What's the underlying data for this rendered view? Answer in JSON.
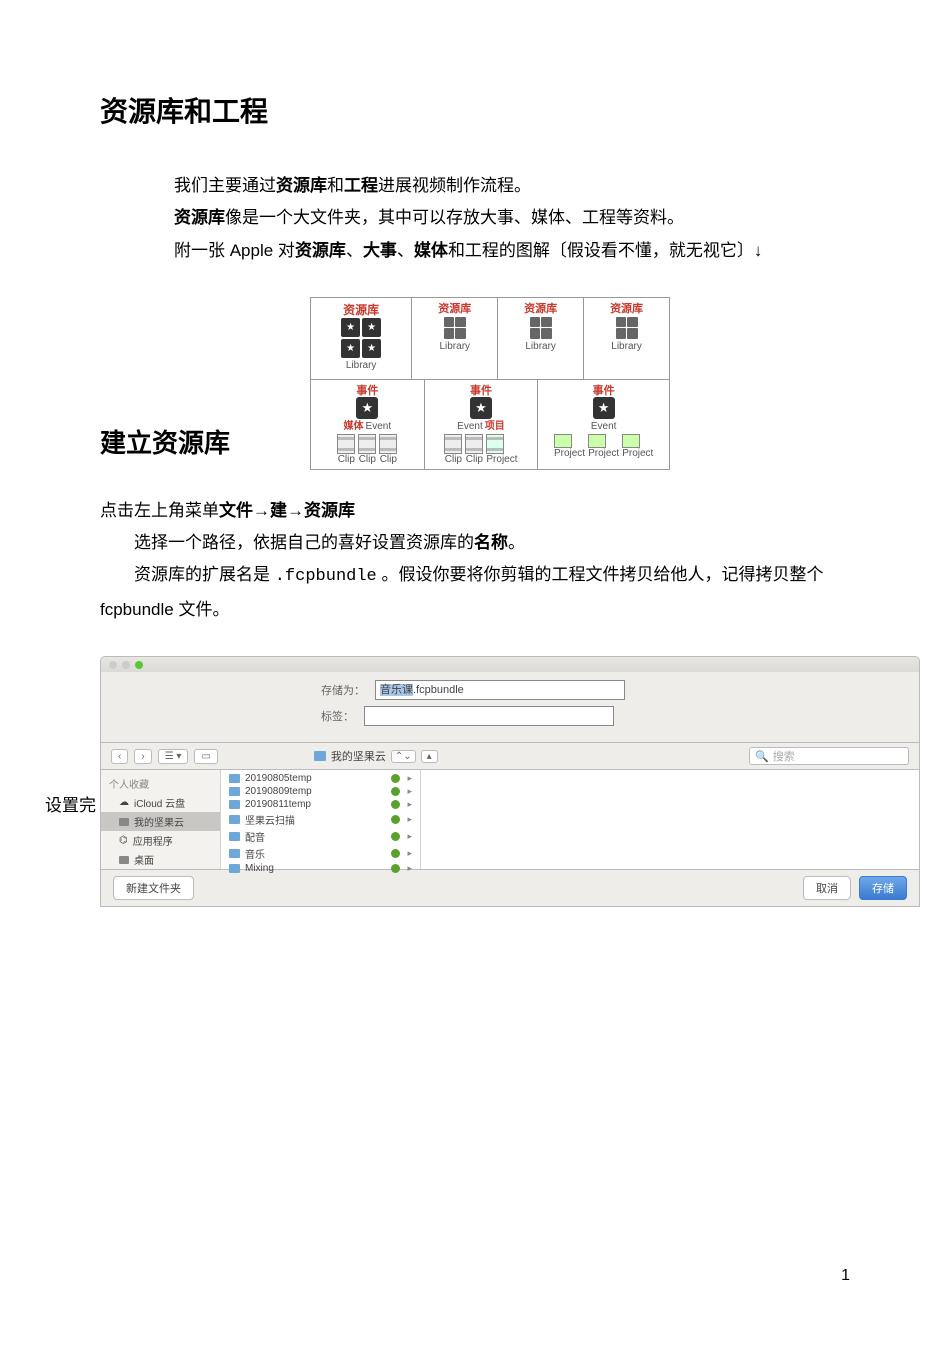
{
  "heading1": "资源库和工程",
  "intro": {
    "l1_pre": "我们主要通过",
    "l1_b1": "资源库",
    "l1_mid": "和",
    "l1_b2": "工程",
    "l1_post": "进展视频制作流程。",
    "l2_b": "资源库",
    "l2_post": "像是一个大文件夹，其中可以存放大事、媒体、工程等资料。",
    "l3_pre": "附一张 Apple 对",
    "l3_b1": "资源库",
    "l3_s1": "、",
    "l3_b2": "大事",
    "l3_s2": "、",
    "l3_b3": "媒体",
    "l3_post": "和工程的图解〔假设看不懂，就无视它〕↓"
  },
  "diagram": {
    "lib_cn": "资源库",
    "lib_en": "Library",
    "event_cn": "事件",
    "event_en": "Event",
    "media_cn": "媒体",
    "clip_en": "Clip",
    "project_cn": "项目",
    "project_en": "Project"
  },
  "heading2": "建立资源库",
  "steps": {
    "l1_pre": "点击左上角菜单",
    "l1_b1": "文件",
    "l1_ar1": "→",
    "l1_b2": "建",
    "l1_ar2": "→",
    "l1_b3": "资源库",
    "l2_pre": "选择一个路径，依据自己的喜好设置资源库的",
    "l2_b": "名称",
    "l2_post": "。",
    "l3_pre": "资源库的扩展名是 ",
    "l3_code": ".fcpbundle",
    "l3_post": " 。假设你要将你剪辑的工程文件拷贝给他人，记得拷贝整个 fcpbundle 文件。"
  },
  "finder": {
    "leftlabel": "设置完",
    "save_as_lbl": "存储为：",
    "save_as_val_sel": "音乐课",
    "save_as_val_ext": ".fcpbundle",
    "tag_lbl": "标签：",
    "nav_back": "‹",
    "nav_fwd": "›",
    "view": "☰ ▾",
    "view2": "▭",
    "path": "我的坚果云",
    "updown": "⌃⌄",
    "caret": "▴",
    "search_icon": "🔍",
    "search_ph": "搜索",
    "sb_header": "个人收藏",
    "sb_items": [
      "iCloud 云盘",
      "我的坚果云",
      "应用程序",
      "桌面"
    ],
    "col_items": [
      "20190805temp",
      "20190809temp",
      "20190811temp",
      "坚果云扫描",
      "配音",
      "音乐",
      "Mixing"
    ],
    "new_folder": "新建文件夹",
    "cancel": "取消",
    "save": "存储"
  },
  "page": "1"
}
